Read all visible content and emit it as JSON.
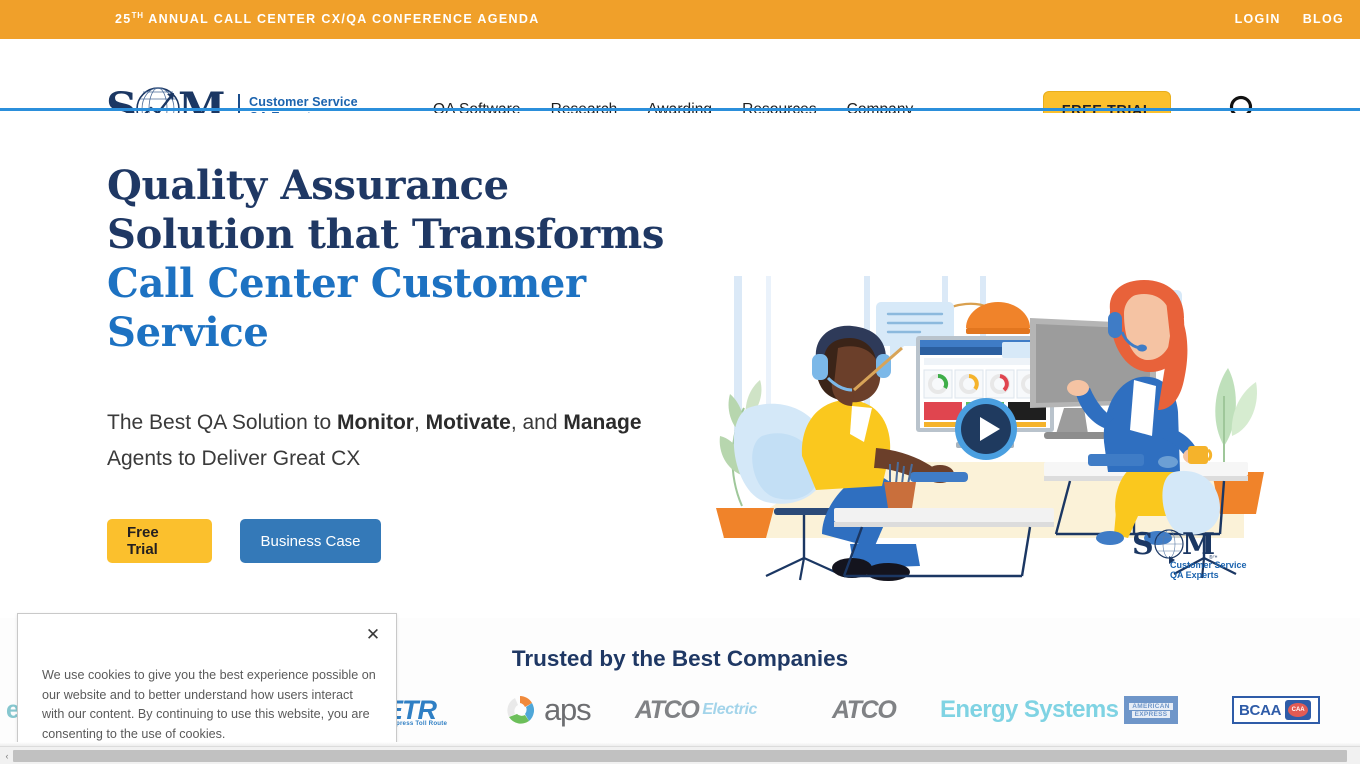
{
  "topbar": {
    "announcement_prefix": "25",
    "announcement_sup": "TH",
    "announcement_rest": " ANNUAL CALL CENTER CX/QA CONFERENCE AGENDA",
    "login_label": "LOGIN",
    "blog_label": "BLOG",
    "bg_color": "#F0A02A"
  },
  "header": {
    "logo": {
      "wordmark": "SQM",
      "tagline_line1": "Customer Service",
      "tagline_line2": "QA Experts",
      "trademark": "®™"
    },
    "nav": [
      {
        "label": "QA Software"
      },
      {
        "label": "Research"
      },
      {
        "label": "Awarding"
      },
      {
        "label": "Resources"
      },
      {
        "label": "Company"
      }
    ],
    "free_trial_label": "FREE TRIAL",
    "search_icon": "search-icon",
    "accent_rule_color": "#2b8fdb"
  },
  "hero": {
    "headline_line1": "Quality Assurance",
    "headline_line2": "Solution that Transforms",
    "headline_line3": "Call Center Customer",
    "headline_line4": "Service",
    "headline_color": "#1f3864",
    "headline_accent_color": "#1d72c2",
    "subhead_1": "The Best QA Solution to ",
    "subhead_b1": "Monitor",
    "subhead_2": ", ",
    "subhead_b2": "Motivate",
    "subhead_3": ", and ",
    "subhead_b3": "Manage",
    "subhead_4": " Agents to Deliver Great CX",
    "cta_primary": "Free Trial",
    "cta_secondary": "Business Case",
    "cta_primary_color": "#FBC02D",
    "cta_secondary_color": "#3479B8",
    "video_play_label": "play-button",
    "illustration_alt": "Two call center agents with headsets at desks using QA dashboard software",
    "watermark_wordmark": "SQM",
    "watermark_tagline1": "Customer Service",
    "watermark_tagline2": "QA Experts"
  },
  "trusted": {
    "title": "Trusted by the Best Companies",
    "logos": [
      {
        "name": "etr",
        "word": "ETR",
        "sub": "Express Toll Route"
      },
      {
        "name": "aps",
        "word": "aps"
      },
      {
        "name": "atco-electric",
        "word": "ATCO",
        "word2": "Electric"
      },
      {
        "name": "atco-energy-systems",
        "word": "ATCO",
        "word2": "Energy Systems"
      },
      {
        "name": "american-express",
        "word1": "AMERICAN",
        "word2": "EXPRESS"
      },
      {
        "name": "bcaa",
        "word": "BCAA",
        "badge": "CAA"
      }
    ]
  },
  "cookie": {
    "close_label": "✕",
    "message": "We use cookies to give you the best experience possible on our website and to better understand how users interact with our content. By continuing to use this website, you are consenting to the use of cookies."
  },
  "scrollbar": {
    "left_arrow": "‹"
  }
}
